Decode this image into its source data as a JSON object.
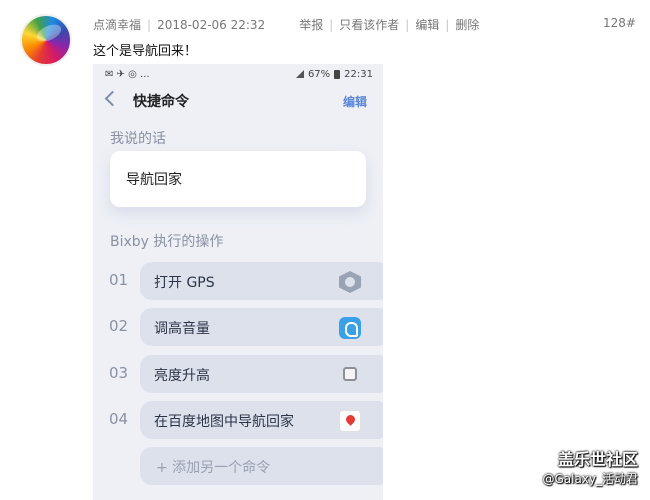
{
  "post": {
    "author": "点滴幸福",
    "date": "2018-02-06 22:32",
    "actions": [
      "举报",
      "只看该作者",
      "编辑",
      "删除"
    ],
    "floor": "128#",
    "text": "这个是导航回来！"
  },
  "phone": {
    "status_left": "✉ ✈ ◎ ...",
    "status_right": "67%",
    "time": "22:31",
    "nav_title": "快捷命令",
    "nav_edit": "编辑",
    "say_section_label": "我说的话",
    "say_phrase": "导航回家",
    "exec_section_label": "Bixby 执行的操作",
    "commands": [
      {
        "num": "01",
        "label": "打开 GPS",
        "icon": "gps-icon"
      },
      {
        "num": "02",
        "label": "调高音量",
        "icon": "volume-icon"
      },
      {
        "num": "03",
        "label": "亮度升高",
        "icon": "brightness-icon"
      },
      {
        "num": "04",
        "label": "在百度地图中导航回家",
        "icon": "map-icon"
      }
    ],
    "add_command": "+ 添加另一个命令"
  },
  "watermark": {
    "title": "盖乐世社区",
    "subtitle": "@Galaxy_活动君"
  },
  "colors": {
    "accent": "#5b86d8",
    "phone_bg": "#eef0f6",
    "pill_bg": "#dde1ec"
  }
}
